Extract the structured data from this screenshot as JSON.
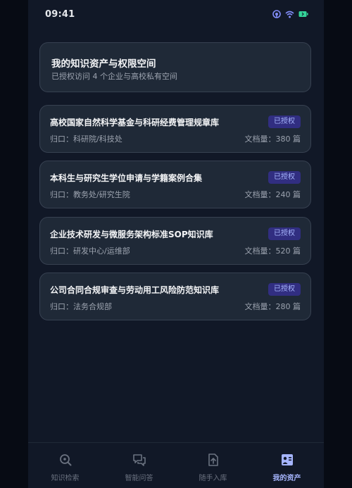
{
  "status_bar": {
    "time": "09:41"
  },
  "header": {
    "title": "我的知识资产与权限空间",
    "subtitle": "已授权访问 4 个企业与高校私有空间"
  },
  "knowledge_bases": [
    {
      "title": "高校国家自然科学基金与科研经费管理规章库",
      "badge": "已授权",
      "owner_label": "归口：",
      "owner": "科研院/科技处",
      "count_label": "文档量：",
      "count": "380 篇"
    },
    {
      "title": "本科生与研究生学位申请与学籍案例合集",
      "badge": "已授权",
      "owner_label": "归口：",
      "owner": "教务处/研究生院",
      "count_label": "文档量：",
      "count": "240 篇"
    },
    {
      "title": "企业技术研发与微服务架构标准SOP知识库",
      "badge": "已授权",
      "owner_label": "归口：",
      "owner": "研发中心/运维部",
      "count_label": "文档量：",
      "count": "520 篇"
    },
    {
      "title": "公司合同合规审查与劳动用工风险防范知识库",
      "badge": "已授权",
      "owner_label": "归口：",
      "owner": "法务合规部",
      "count_label": "文档量：",
      "count": "280 篇"
    }
  ],
  "tab_bar": {
    "tabs": [
      {
        "label": "知识检索",
        "icon": "search-icon",
        "active": false
      },
      {
        "label": "智能问答",
        "icon": "chat-icon",
        "active": false
      },
      {
        "label": "随手入库",
        "icon": "upload-icon",
        "active": false
      },
      {
        "label": "我的资产",
        "icon": "assets-icon",
        "active": true
      }
    ]
  },
  "colors": {
    "background": "#111827",
    "card": "#1f2937",
    "accent": "#a5b4fc",
    "badge_bg": "#312e81",
    "signal_icon": "#818cf8",
    "battery_icon": "#34d399"
  }
}
